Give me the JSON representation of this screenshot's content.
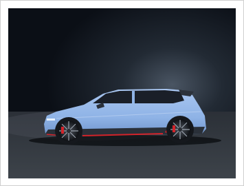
{
  "image": {
    "subject": "car-side-profile-photo",
    "colors": {
      "frame_border": "#cfcfcf",
      "frame_bg": "#ffffff",
      "backdrop_top": "#0b0f16",
      "backdrop_mid": "#1f252d",
      "floor": "#3b4047",
      "car_body": "#8fb3e6",
      "car_body_shadow": "#6f94cc",
      "glass": "#1a1f28",
      "accent_red": "#d3232a",
      "wheel_dark": "#15181d"
    }
  }
}
